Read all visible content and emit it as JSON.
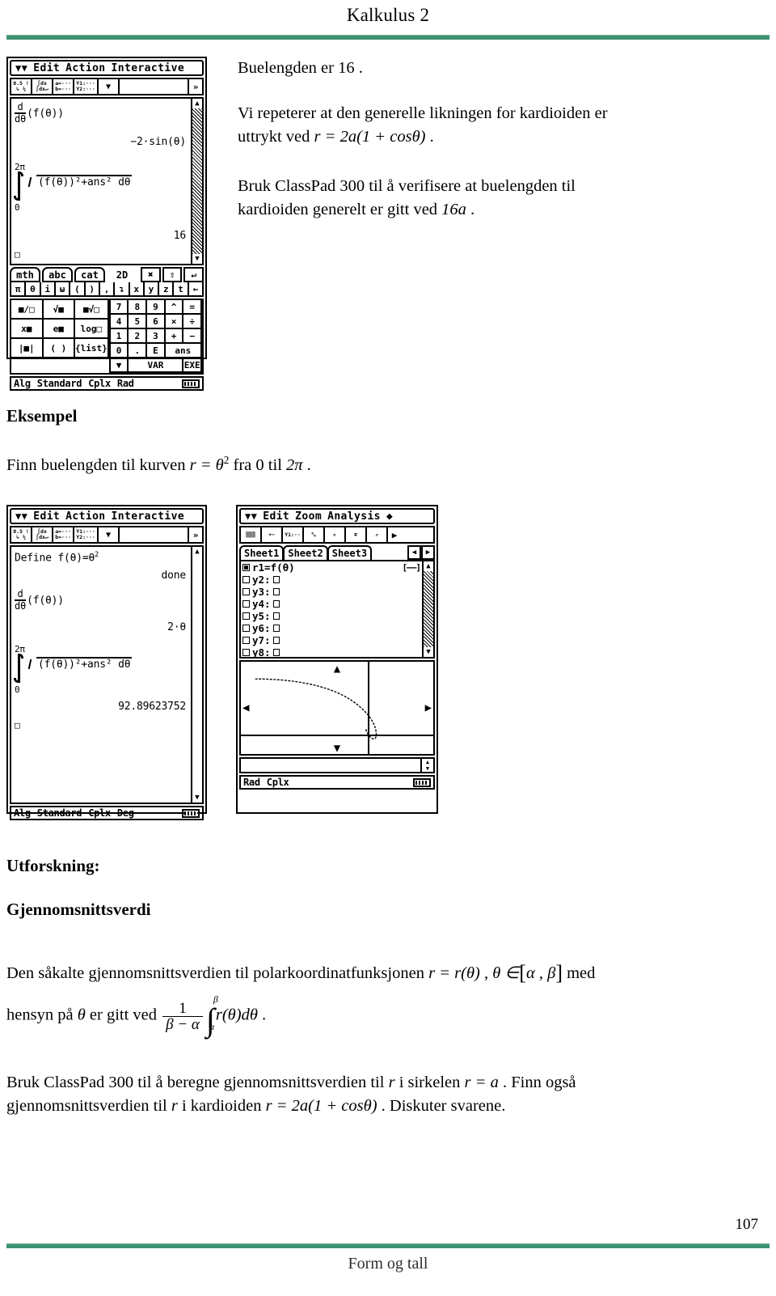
{
  "header": {
    "title": "Kalkulus 2"
  },
  "footer": {
    "text": "Form og tall",
    "page_number": "107"
  },
  "colors": {
    "rule_green": "#3f9272",
    "rule_green_light": "#6bb095",
    "text": "#000000"
  },
  "body": {
    "p1": "Buelengden er 16 .",
    "p2_line1": "Vi repeterer at den generelle likningen for kardioiden er",
    "p2_line2_prefix": "uttrykt ved ",
    "p2_formula": "r = 2a(1 + cosθ)",
    "p2_suffix": " .",
    "p3_line1": "Bruk ClassPad 300 til å verifisere at buelengden til",
    "p3_line2_prefix": "kardioiden generelt er gitt ved ",
    "p3_formula": "16a",
    "p3_suffix": " .",
    "heading_eksempel": "Eksempel",
    "p4_prefix": "Finn buelengden til kurven ",
    "p4_formula_r": "r = θ",
    "p4_formula_exp": "2",
    "p4_mid": " fra ",
    "p4_from": "0",
    "p4_til": " til ",
    "p4_to": "2π",
    "p4_suffix": " .",
    "heading_utforskning": "Utforskning:",
    "heading_gjennomsnittsverdi": "Gjennomsnittsverdi",
    "p5_a": "Den såkalte gjennomsnittsverdien til polarkoordinatfunksjonen ",
    "p5_f1": "r = r(θ)",
    "p5_b": " ,  ",
    "p5_f2": "θ ∈",
    "p5_bracket_open": "[",
    "p5_ab": "α , β",
    "p5_bracket_close": "]",
    "p5_c": " med",
    "p6_prefix": "hensyn på ",
    "p6_theta": "θ",
    "p6_mid": " er gitt ved ",
    "frac_num": "1",
    "frac_den": "β − α",
    "int_upper": "β",
    "int_lower": "α",
    "int_body": "r(θ)dθ",
    "p6_suffix": " .",
    "p7_a": "Bruk ClassPad 300 til å beregne gjennomsnittsverdien til ",
    "p7_r1": "r",
    "p7_b": " i sirkelen ",
    "p7_f1": "r = a",
    "p7_c": " . Finn også",
    "p8_a": "gjennomsnittsverdien til ",
    "p8_r": "r",
    "p8_b": " i kardioiden ",
    "p8_f": "r = 2a(1 + cosθ)",
    "p8_c": " . Diskuter svarene."
  },
  "classpad_main": {
    "menubar": {
      "arrow_icon": "down-chevron-icon",
      "items": [
        "Edit",
        "Action",
        "Interactive"
      ]
    },
    "toolbar_buttons": [
      {
        "name": "decimal-fraction-toggle",
        "top": "0.5 !",
        "bottom": "↳ ½"
      },
      {
        "name": "derivative-integral-button",
        "top": "∫dx",
        "bottom": "∫dx↵"
      },
      {
        "name": "variable-ab-button",
        "top": "a=···",
        "bottom": "b=···"
      },
      {
        "name": "graph-y1y2-button",
        "top": "Y1:···",
        "bottom": "Y2:···"
      },
      {
        "name": "dropdown-button",
        "top": "▼",
        "bottom": ""
      }
    ],
    "toolbar_end_icon": "expand-icon",
    "screen_lines": [
      {
        "name": "derivative-expression",
        "text": "(f(θ))",
        "prefix": "d / dθ"
      },
      {
        "name": "derivative-result",
        "text": "−2·sin(θ)",
        "align": "right"
      },
      {
        "name": "integral-upper-limit",
        "text": "2π"
      },
      {
        "name": "integral-lower-limit",
        "text": "0"
      },
      {
        "name": "integral-expression",
        "text": "(f(θ))²+ans²  dθ"
      },
      {
        "name": "integral-result",
        "text": "16",
        "align": "right"
      }
    ],
    "cursor": "□",
    "status": {
      "mode": "Alg",
      "number": "Standard",
      "complex": "Cplx",
      "angle": "Rad",
      "battery_icon": "battery-icon"
    },
    "keyboard": {
      "tabs": [
        "mth",
        "abc",
        "cat",
        "2D"
      ],
      "tab_icons": [
        "close-icon",
        "shift-up-icon",
        "enter-down-icon"
      ],
      "symbol_row": [
        "π",
        "θ",
        "i",
        "ω",
        "(",
        ")",
        ",",
        "↴",
        "x",
        "y",
        "z",
        "t",
        "←"
      ],
      "fn_keys": [
        "fraction-icon",
        "sqrt-icon",
        "nth-root-icon",
        "power-icon",
        "exp-icon",
        "log-icon",
        "abs-icon",
        "parens-icon",
        "list-icon"
      ],
      "fn_labels": [
        "■/□",
        "√■",
        "■√□",
        "x■",
        "e■",
        "log□",
        "|■|",
        "( )",
        "{list}"
      ],
      "numpad": [
        "7",
        "8",
        "9",
        "^",
        "=",
        "4",
        "5",
        "6",
        "×",
        "÷",
        "1",
        "2",
        "3",
        "+",
        "−",
        "0",
        ".",
        "E",
        "ans"
      ],
      "bottom": [
        "▼",
        "VAR",
        "EXE"
      ]
    }
  },
  "classpad_define": {
    "menubar": {
      "arrow_icon": "down-chevron-icon",
      "items": [
        "Edit",
        "Action",
        "Interactive"
      ]
    },
    "screen_lines": [
      {
        "name": "define-command",
        "text": "Define f(θ)=θ",
        "exp": "2"
      },
      {
        "name": "define-result",
        "text": "done",
        "align": "right"
      },
      {
        "name": "derivative-expression",
        "text": "(f(θ))",
        "prefix": "d / dθ"
      },
      {
        "name": "derivative-result",
        "text": "2·θ",
        "align": "right"
      },
      {
        "name": "integral-upper-limit",
        "text": "2π"
      },
      {
        "name": "integral-lower-limit",
        "text": "0"
      },
      {
        "name": "integral-expression",
        "text": "(f(θ))²+ans²  dθ"
      },
      {
        "name": "integral-result",
        "text": "92.89623752",
        "align": "right"
      }
    ],
    "cursor": "□",
    "status": {
      "mode": "Alg",
      "number": "Standard",
      "complex": "Cplx",
      "angle": "Deg",
      "battery_icon": "battery-icon"
    }
  },
  "classpad_graph": {
    "menubar": {
      "arrow_icon": "down-chevron-icon",
      "items": [
        "Edit",
        "Zoom",
        "Analysis"
      ],
      "extra_icon": "diamond-icon"
    },
    "toolbar_buttons": [
      {
        "name": "table-icon",
        "label": "▒▒▒"
      },
      {
        "name": "table-settings-icon",
        "label": "+−"
      },
      {
        "name": "y1y2-icon",
        "label": "Y1:··"
      },
      {
        "name": "zoom-box-icon",
        "label": "⤡"
      },
      {
        "name": "zoom-auto-icon",
        "label": "✲"
      },
      {
        "name": "zoom-in-icon",
        "label": "⌗"
      },
      {
        "name": "graph-draw-icon",
        "label": "↗"
      }
    ],
    "toolbar_end_icon": "right-arrow-icon",
    "sheets": [
      "Sheet1",
      "Sheet2",
      "Sheet3"
    ],
    "sheet_nav": [
      "◀",
      "▶"
    ],
    "functions": [
      {
        "name": "function-r1",
        "checked": true,
        "label": "r1=f(θ)",
        "style": "[——]"
      },
      {
        "name": "function-y2",
        "checked": false,
        "label": "y2:",
        "style": ""
      },
      {
        "name": "function-y3",
        "checked": false,
        "label": "y3:",
        "style": ""
      },
      {
        "name": "function-y4",
        "checked": false,
        "label": "y4:",
        "style": ""
      },
      {
        "name": "function-y5",
        "checked": false,
        "label": "y5:",
        "style": ""
      },
      {
        "name": "function-y6",
        "checked": false,
        "label": "y6:",
        "style": ""
      },
      {
        "name": "function-y7",
        "checked": false,
        "label": "y7:",
        "style": ""
      },
      {
        "name": "function-y8",
        "checked": false,
        "label": "y8:",
        "style": ""
      }
    ],
    "plot": {
      "name": "polar-curve-plot",
      "pan_icons": [
        "up-arrow-icon",
        "down-arrow-icon",
        "left-arrow-icon",
        "right-arrow-icon"
      ],
      "curve_description": "spiral r = theta squared from 0 to 2pi"
    },
    "entry_value": "",
    "status": {
      "angle": "Rad",
      "complex": "Cplx",
      "battery_icon": "battery-icon"
    }
  }
}
